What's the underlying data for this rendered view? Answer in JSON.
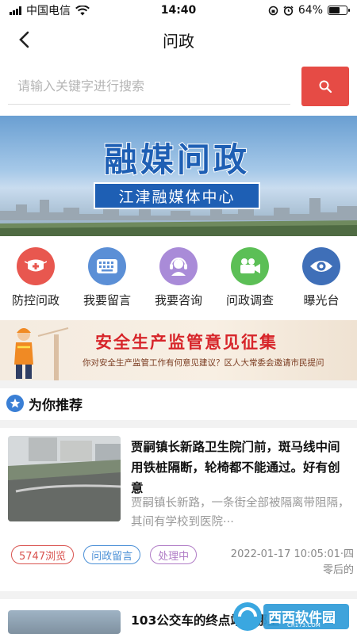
{
  "status_bar": {
    "carrier": "中国电信",
    "time": "14:40",
    "battery": "64%",
    "battery_level": 0.64
  },
  "nav": {
    "title": "问政",
    "back_icon": "chevron-left-icon"
  },
  "search": {
    "placeholder": "请输入关键字进行搜索",
    "value": "",
    "button_icon": "search-icon"
  },
  "banner": {
    "title": "融媒问政",
    "subtitle": "江津融媒体中心"
  },
  "menu": [
    {
      "label": "防控问政",
      "icon": "mask-icon",
      "color": "#e8574f"
    },
    {
      "label": "我要留言",
      "icon": "keyboard-icon",
      "color": "#5b8fd6"
    },
    {
      "label": "我要咨询",
      "icon": "headset-icon",
      "color": "#a98bd8"
    },
    {
      "label": "问政调查",
      "icon": "video-camera-icon",
      "color": "#5cbf56"
    },
    {
      "label": "曝光台",
      "icon": "eye-icon",
      "color": "#3f6fb8"
    }
  ],
  "survey_banner": {
    "title": "安全生产监管意见征集",
    "subtitle": "你对安全生产监管工作有何意见建议？区人大常委会邀请市民提问"
  },
  "recommend": {
    "title": "为你推荐",
    "icon": "star-icon"
  },
  "articles": [
    {
      "title": "贾嗣镇长新路卫生院门前，斑马线中间用铁桩隔断，轮椅都不能通过。好有创意",
      "summary": "贾嗣镇长新路，一条街全部被隔离带阻隔，其间有学校到医院···",
      "tags": [
        "5747浏览",
        "问政留言",
        "处理中"
      ],
      "time": "2022-01-17 10:05:01·四零后的"
    },
    {
      "title": "103公交车的终点站是哪里"
    }
  ],
  "colors": {
    "accent": "#e64b45",
    "tag_views": "#d9534f",
    "tag_type": "#4a8fd6",
    "tag_status": "#b07cc6"
  },
  "watermark": {
    "text": "西西软件园",
    "sub": "CR173.COM"
  }
}
